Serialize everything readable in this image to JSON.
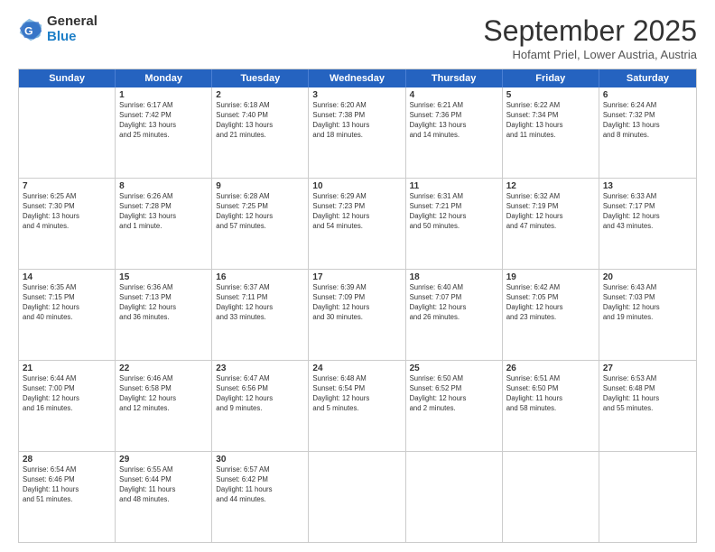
{
  "logo": {
    "general": "General",
    "blue": "Blue"
  },
  "title": "September 2025",
  "location": "Hofamt Priel, Lower Austria, Austria",
  "days_header": [
    "Sunday",
    "Monday",
    "Tuesday",
    "Wednesday",
    "Thursday",
    "Friday",
    "Saturday"
  ],
  "weeks": [
    [
      {
        "day": "",
        "info": ""
      },
      {
        "day": "1",
        "info": "Sunrise: 6:17 AM\nSunset: 7:42 PM\nDaylight: 13 hours\nand 25 minutes."
      },
      {
        "day": "2",
        "info": "Sunrise: 6:18 AM\nSunset: 7:40 PM\nDaylight: 13 hours\nand 21 minutes."
      },
      {
        "day": "3",
        "info": "Sunrise: 6:20 AM\nSunset: 7:38 PM\nDaylight: 13 hours\nand 18 minutes."
      },
      {
        "day": "4",
        "info": "Sunrise: 6:21 AM\nSunset: 7:36 PM\nDaylight: 13 hours\nand 14 minutes."
      },
      {
        "day": "5",
        "info": "Sunrise: 6:22 AM\nSunset: 7:34 PM\nDaylight: 13 hours\nand 11 minutes."
      },
      {
        "day": "6",
        "info": "Sunrise: 6:24 AM\nSunset: 7:32 PM\nDaylight: 13 hours\nand 8 minutes."
      }
    ],
    [
      {
        "day": "7",
        "info": "Sunrise: 6:25 AM\nSunset: 7:30 PM\nDaylight: 13 hours\nand 4 minutes."
      },
      {
        "day": "8",
        "info": "Sunrise: 6:26 AM\nSunset: 7:28 PM\nDaylight: 13 hours\nand 1 minute."
      },
      {
        "day": "9",
        "info": "Sunrise: 6:28 AM\nSunset: 7:25 PM\nDaylight: 12 hours\nand 57 minutes."
      },
      {
        "day": "10",
        "info": "Sunrise: 6:29 AM\nSunset: 7:23 PM\nDaylight: 12 hours\nand 54 minutes."
      },
      {
        "day": "11",
        "info": "Sunrise: 6:31 AM\nSunset: 7:21 PM\nDaylight: 12 hours\nand 50 minutes."
      },
      {
        "day": "12",
        "info": "Sunrise: 6:32 AM\nSunset: 7:19 PM\nDaylight: 12 hours\nand 47 minutes."
      },
      {
        "day": "13",
        "info": "Sunrise: 6:33 AM\nSunset: 7:17 PM\nDaylight: 12 hours\nand 43 minutes."
      }
    ],
    [
      {
        "day": "14",
        "info": "Sunrise: 6:35 AM\nSunset: 7:15 PM\nDaylight: 12 hours\nand 40 minutes."
      },
      {
        "day": "15",
        "info": "Sunrise: 6:36 AM\nSunset: 7:13 PM\nDaylight: 12 hours\nand 36 minutes."
      },
      {
        "day": "16",
        "info": "Sunrise: 6:37 AM\nSunset: 7:11 PM\nDaylight: 12 hours\nand 33 minutes."
      },
      {
        "day": "17",
        "info": "Sunrise: 6:39 AM\nSunset: 7:09 PM\nDaylight: 12 hours\nand 30 minutes."
      },
      {
        "day": "18",
        "info": "Sunrise: 6:40 AM\nSunset: 7:07 PM\nDaylight: 12 hours\nand 26 minutes."
      },
      {
        "day": "19",
        "info": "Sunrise: 6:42 AM\nSunset: 7:05 PM\nDaylight: 12 hours\nand 23 minutes."
      },
      {
        "day": "20",
        "info": "Sunrise: 6:43 AM\nSunset: 7:03 PM\nDaylight: 12 hours\nand 19 minutes."
      }
    ],
    [
      {
        "day": "21",
        "info": "Sunrise: 6:44 AM\nSunset: 7:00 PM\nDaylight: 12 hours\nand 16 minutes."
      },
      {
        "day": "22",
        "info": "Sunrise: 6:46 AM\nSunset: 6:58 PM\nDaylight: 12 hours\nand 12 minutes."
      },
      {
        "day": "23",
        "info": "Sunrise: 6:47 AM\nSunset: 6:56 PM\nDaylight: 12 hours\nand 9 minutes."
      },
      {
        "day": "24",
        "info": "Sunrise: 6:48 AM\nSunset: 6:54 PM\nDaylight: 12 hours\nand 5 minutes."
      },
      {
        "day": "25",
        "info": "Sunrise: 6:50 AM\nSunset: 6:52 PM\nDaylight: 12 hours\nand 2 minutes."
      },
      {
        "day": "26",
        "info": "Sunrise: 6:51 AM\nSunset: 6:50 PM\nDaylight: 11 hours\nand 58 minutes."
      },
      {
        "day": "27",
        "info": "Sunrise: 6:53 AM\nSunset: 6:48 PM\nDaylight: 11 hours\nand 55 minutes."
      }
    ],
    [
      {
        "day": "28",
        "info": "Sunrise: 6:54 AM\nSunset: 6:46 PM\nDaylight: 11 hours\nand 51 minutes."
      },
      {
        "day": "29",
        "info": "Sunrise: 6:55 AM\nSunset: 6:44 PM\nDaylight: 11 hours\nand 48 minutes."
      },
      {
        "day": "30",
        "info": "Sunrise: 6:57 AM\nSunset: 6:42 PM\nDaylight: 11 hours\nand 44 minutes."
      },
      {
        "day": "",
        "info": ""
      },
      {
        "day": "",
        "info": ""
      },
      {
        "day": "",
        "info": ""
      },
      {
        "day": "",
        "info": ""
      }
    ]
  ]
}
